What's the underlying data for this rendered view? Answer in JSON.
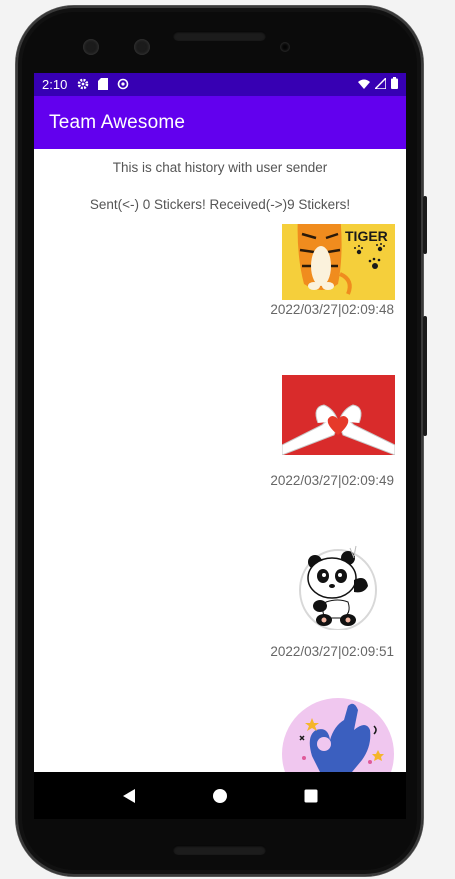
{
  "status_bar": {
    "time": "2:10",
    "icons": [
      "gear-icon",
      "sd-card-icon",
      "sync-icon",
      "wifi-icon",
      "signal-icon",
      "battery-icon"
    ]
  },
  "app_bar": {
    "title": "Team Awesome"
  },
  "chat": {
    "header_line": "This is chat history with user sender",
    "summary_line": "Sent(<-) 0 Stickers! Received(->)9 Stickers!",
    "messages": [
      {
        "sticker": "tiger-sticker",
        "sticker_text": "TIGER",
        "timestamp": "2022/03/27|02:09:48"
      },
      {
        "sticker": "heart-hands-sticker",
        "timestamp": "2022/03/27|02:09:49"
      },
      {
        "sticker": "panda-sticker",
        "timestamp": "2022/03/27|02:09:51"
      },
      {
        "sticker": "ok-hand-sticker"
      }
    ]
  },
  "nav_bar": {
    "buttons": [
      "back-icon",
      "home-icon",
      "recents-icon"
    ]
  },
  "colors": {
    "status_bar": "#3700b3",
    "app_bar": "#6200ee",
    "text_secondary": "#555555"
  }
}
